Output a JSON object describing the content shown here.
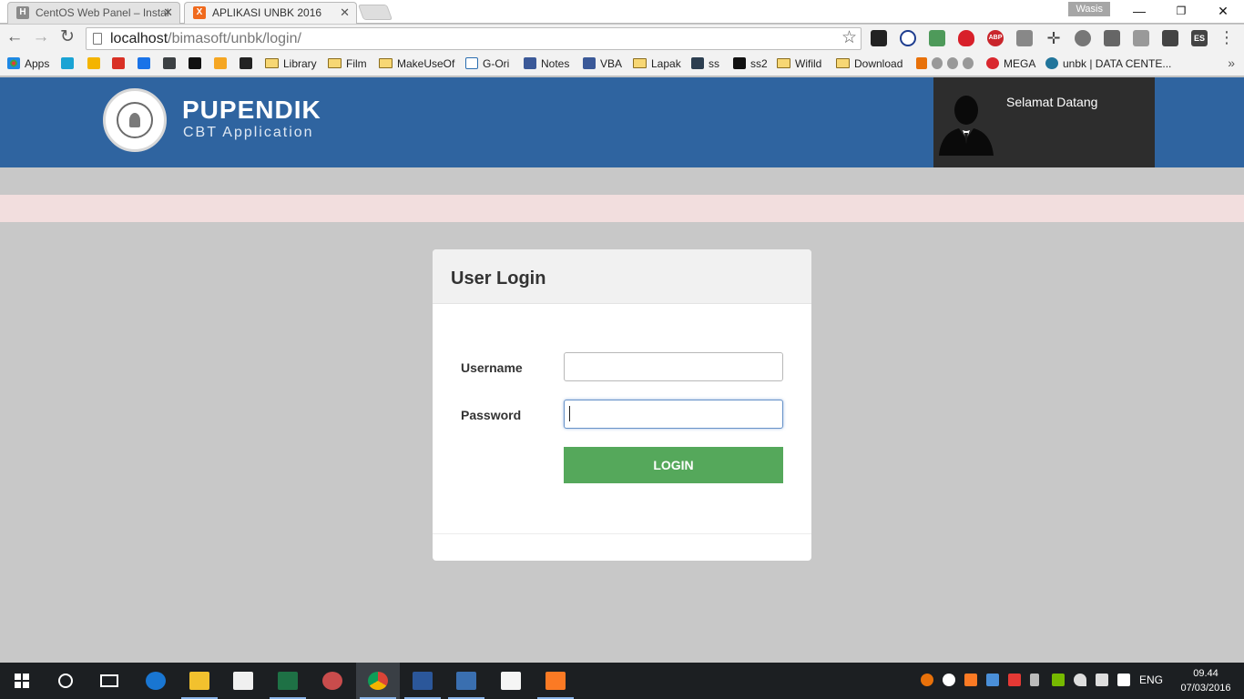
{
  "browser": {
    "tabs": [
      {
        "label": "CentOS Web Panel – Instal",
        "favicon": "H",
        "active": false
      },
      {
        "label": "APLIKASI UNBK 2016",
        "favicon": "X",
        "active": true
      }
    ],
    "user_badge": "Wasis",
    "url_host": "localhost",
    "url_path": "/bimasoft/unbk/login/",
    "bookmarks": [
      "Apps",
      "Library",
      "Film",
      "MakeUseOf",
      "G-Ori",
      "Notes",
      "VBA",
      "Lapak",
      "ss",
      "ss2",
      "Wifild",
      "Download",
      "MEGA",
      "unbk | DATA CENTE..."
    ],
    "extension_labels": {
      "abp": "ABP",
      "es": "ES"
    }
  },
  "header": {
    "brand_title": "PUPENDIK",
    "brand_subtitle": "CBT Application",
    "welcome": "Selamat Datang"
  },
  "login": {
    "title": "User Login",
    "username_label": "Username",
    "password_label": "Password",
    "username_value": "",
    "password_value": "",
    "button_label": "LOGIN"
  },
  "taskbar": {
    "language": "ENG",
    "time": "09.44",
    "date": "07/03/2016"
  },
  "colors": {
    "header_bg": "#2f64a0",
    "user_box_bg": "#2d2d2d",
    "alert_bg": "#f2dede",
    "page_bg": "#c8c8c8",
    "login_button": "#55a85b"
  }
}
